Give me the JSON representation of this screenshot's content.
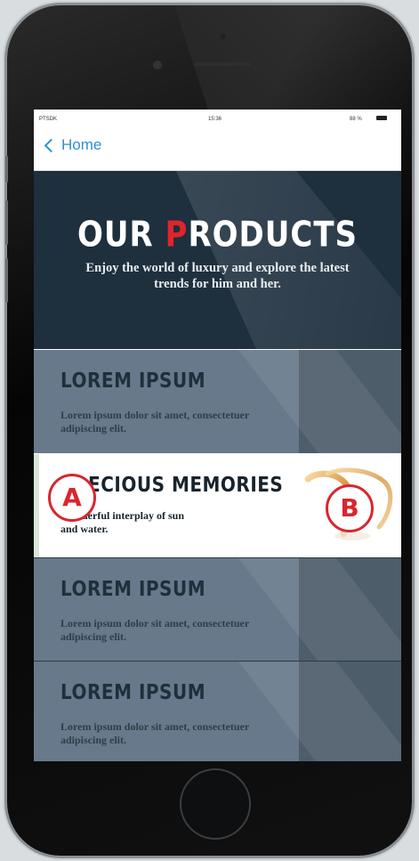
{
  "status": {
    "carrier": "PTSDK",
    "time": "15:36",
    "battery": "88 %"
  },
  "nav": {
    "back_label": "Home"
  },
  "hero": {
    "title_prefix": "OUR ",
    "title_accent": "P",
    "title_rest": "RODUCTS",
    "subtitle": "Enjoy the world of luxury and explore the latest trends for him and her."
  },
  "items": [
    {
      "title": "LOREM IPSUM",
      "desc": "Lorem ipsum dolor sit amet, consectetuer adipiscing elit."
    },
    {
      "title": "PRECIOUS MEMORIES",
      "desc": "Wonderful interplay of sun and water."
    },
    {
      "title": "LOREM IPSUM",
      "desc": "Lorem ipsum dolor sit amet, consectetuer adipiscing elit."
    },
    {
      "title": "LOREM IPSUM",
      "desc": "Lorem ipsum dolor sit amet, consectetuer adipiscing elit."
    }
  ],
  "markers": {
    "a": "A",
    "b": "B"
  },
  "colors": {
    "accent_red": "#e0242b",
    "link_blue": "#2d8fd5",
    "hero_bg": "#1e2f3e",
    "item_bg": "#67798a"
  },
  "icons": {
    "back": "chevron-left-icon",
    "battery": "battery-icon",
    "product_image": "gold-rings-icon"
  }
}
